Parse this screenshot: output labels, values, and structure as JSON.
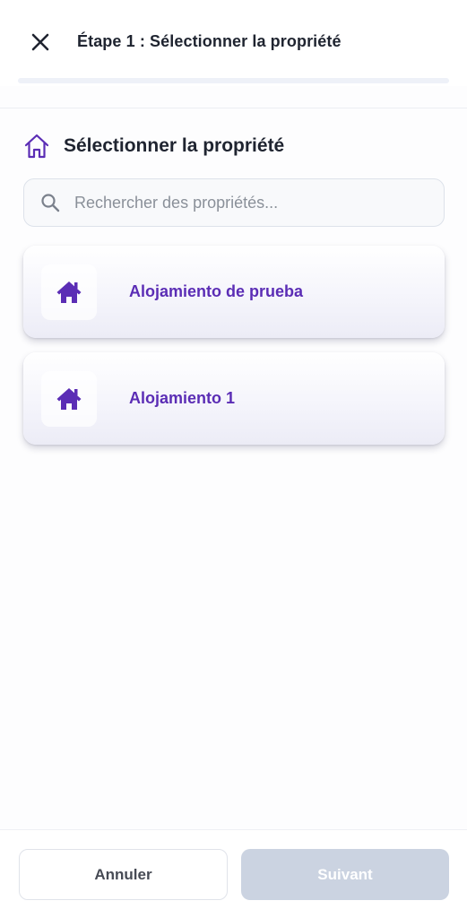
{
  "header": {
    "title": "Étape 1 : Sélectionner la propriété",
    "close_icon": "close-icon"
  },
  "progress": {
    "step": 1,
    "fraction": 0.0
  },
  "section": {
    "title": "Sélectionner la propriété",
    "icon": "house-outline-icon"
  },
  "search": {
    "placeholder": "Rechercher des propriétés...",
    "value": "",
    "icon": "search-icon"
  },
  "properties": [
    {
      "name": "Alojamiento de prueba",
      "icon": "house-icon"
    },
    {
      "name": "Alojamiento 1",
      "icon": "house-icon"
    }
  ],
  "footer": {
    "cancel_label": "Annuler",
    "next_label": "Suivant",
    "next_enabled": false
  },
  "colors": {
    "accent": "#5b2db5",
    "disabled_button": "#cbd3e1"
  }
}
